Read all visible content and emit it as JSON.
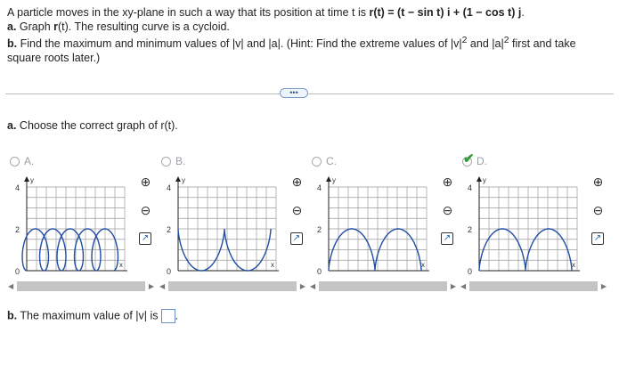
{
  "problem": {
    "intro_pre": "A particle moves in the xy-plane in such a way that its position at time t is ",
    "intro_formula": "r(t) = (t − sin t) i + (1 − cos t) j",
    "intro_post": ".",
    "part_a_label": "a.",
    "part_a_text": " Graph ",
    "part_a_bold": "r",
    "part_a_rest": "(t). The resulting curve is a cycloid.",
    "part_b_label": "b.",
    "part_b_text": " Find the maximum and minimum values of |v| and |a|. (Hint: Find the extreme values of |v|",
    "part_b_sup": "2",
    "part_b_mid": " and |a|",
    "part_b_sup2": "2",
    "part_b_end": " first and take square roots later.)"
  },
  "more_button": "•••",
  "question_a": {
    "label": "a.",
    "text": " Choose the correct graph of r(t)."
  },
  "options": [
    {
      "letter": "A.",
      "selected": false
    },
    {
      "letter": "B.",
      "selected": false
    },
    {
      "letter": "C.",
      "selected": false
    },
    {
      "letter": "D.",
      "selected": true
    }
  ],
  "axis": {
    "y_label": "y",
    "x_label": "x",
    "tick_4": "4",
    "tick_2": "2",
    "tick_0": "0"
  },
  "question_b": {
    "label": "b.",
    "text": " The maximum value of |v| is"
  },
  "colors": {
    "curve": "#1f4ea3",
    "check": "#2e9b2e",
    "grid": "#9a9a9a",
    "link": "#1a5fb4"
  }
}
